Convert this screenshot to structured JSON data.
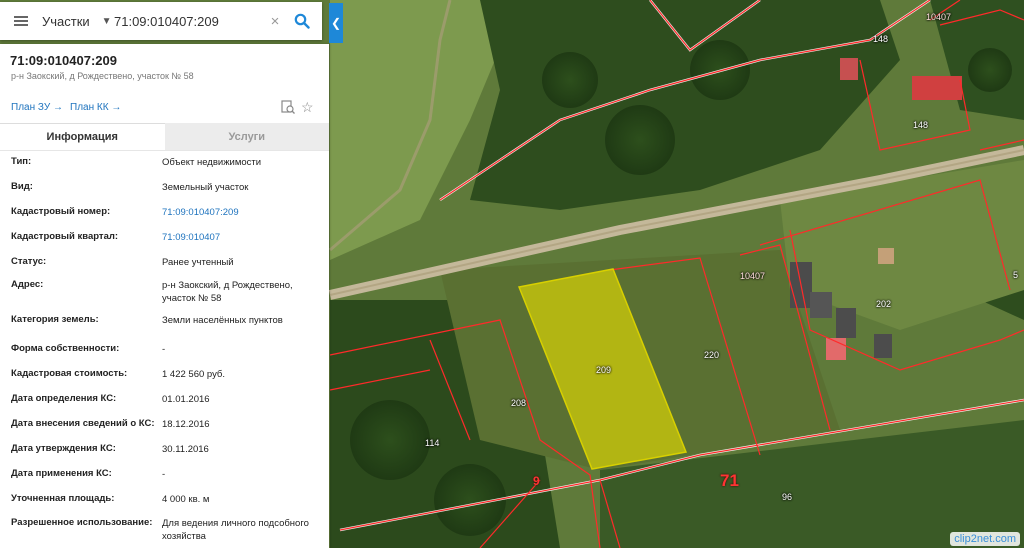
{
  "search": {
    "type_label": "Участки",
    "query": "71:09:010407:209"
  },
  "object": {
    "title": "71:09:010407:209",
    "subtitle": "р-н Заокский, д Рождествено, участок № 58"
  },
  "links": {
    "plan_zu": "План ЗУ",
    "plan_kk": "План КК"
  },
  "tabs": {
    "info": "Информация",
    "services": "Услуги"
  },
  "properties": [
    {
      "key": "Тип:",
      "value": "Объект недвижимости"
    },
    {
      "key": "Вид:",
      "value": "Земельный участок"
    },
    {
      "key": "Кадастровый номер:",
      "value": "71:09:010407:209",
      "link": true
    },
    {
      "key": "Кадастровый квартал:",
      "value": "71:09:010407",
      "link": true
    },
    {
      "key": "Статус:",
      "value": "Ранее учтенный"
    },
    {
      "key": "Адрес:",
      "value": "р-н Заокский, д Рождествено, участок № 58"
    },
    {
      "key": "Категория земель:",
      "value": "Земли населённых пунктов"
    },
    {
      "key": "Форма собственности:",
      "value": "-"
    },
    {
      "key": "Кадастровая стоимость:",
      "value": "1 422 560 руб."
    },
    {
      "key": "Дата определения КС:",
      "value": "01.01.2016"
    },
    {
      "key": "Дата внесения сведений о КС:",
      "value": "18.12.2016"
    },
    {
      "key": "Дата утверждения КС:",
      "value": "30.11.2016"
    },
    {
      "key": "Дата применения КС:",
      "value": "-"
    },
    {
      "key": "Уточненная площадь:",
      "value": "4 000 кв. м"
    },
    {
      "key": "Разрешенное использование:",
      "value": "Для ведения личного подсобного хозяйства"
    }
  ],
  "map": {
    "labels": [
      "10407",
      "148",
      "148",
      "10407",
      "202",
      "220",
      "209",
      "208",
      "114",
      "9",
      "71",
      "96",
      "5"
    ],
    "watermark": "clip2net.com"
  },
  "colors": {
    "accent": "#1e88d8",
    "link": "#1e73be",
    "selected_plot": "#e8e000",
    "boundary": "#ff2a2a"
  }
}
